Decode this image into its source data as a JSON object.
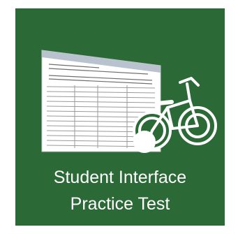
{
  "tile": {
    "title_line1": "Student Interface",
    "title_line2": "Practice Test",
    "background_color": "#2b6a36",
    "icons": [
      "document-screenshot-icon",
      "bicycle-with-training-wheels-icon"
    ]
  }
}
